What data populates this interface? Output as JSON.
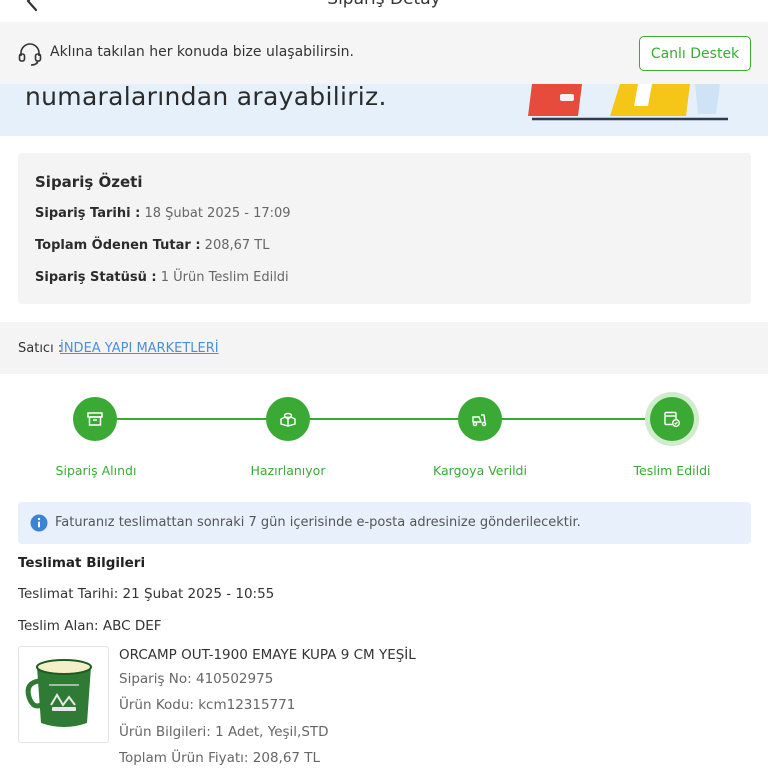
{
  "header": {
    "title": "Sipariş Detay"
  },
  "support": {
    "text": "Aklına takılan her konuda bize ulaşabilirsin.",
    "button_label": "Canlı Destek"
  },
  "banner": {
    "text": "numaralarından arayabiliriz."
  },
  "summary": {
    "title": "Sipariş Özeti",
    "rows": [
      {
        "label": "Sipariş Tarihi :",
        "value": "18 Şubat 2025 - 17:09"
      },
      {
        "label": "Toplam Ödenen Tutar :",
        "value": "208,67 TL"
      },
      {
        "label": "Sipariş Statüsü :",
        "value": "1 Ürün Teslim Edildi"
      }
    ]
  },
  "seller": {
    "label": "Satıcı :",
    "name": "İNDEA YAPI MARKETLERİ"
  },
  "tracker": {
    "steps": [
      {
        "label": "Sipariş Alındı",
        "icon": "box-icon"
      },
      {
        "label": "Hazırlanıyor",
        "icon": "package-prep-icon"
      },
      {
        "label": "Kargoya Verildi",
        "icon": "truck-icon"
      },
      {
        "label": "Teslim Edildi",
        "icon": "delivered-box-icon"
      }
    ],
    "accent": "#3aaa35"
  },
  "info": {
    "text": "Faturanız teslimattan sonraki 7 gün içerisinde e-posta adresinize gönderilecektir."
  },
  "delivery": {
    "title": "Teslimat Bilgileri",
    "date": "Teslimat Tarihi: 21 Şubat 2025 - 10:55",
    "receiver": "Teslim Alan: ABC DEF"
  },
  "product": {
    "name": "ORCAMP OUT-1900 EMAYE KUPA 9 CM YEŞİL",
    "order_no": "Sipariş No: 410502975",
    "code": "Ürün Kodu: kcm12315771",
    "info": "Ürün Bilgileri: 1 Adet, Yeşil,STD",
    "price": "Toplam Ürün Fiyatı: 208,67 TL"
  }
}
